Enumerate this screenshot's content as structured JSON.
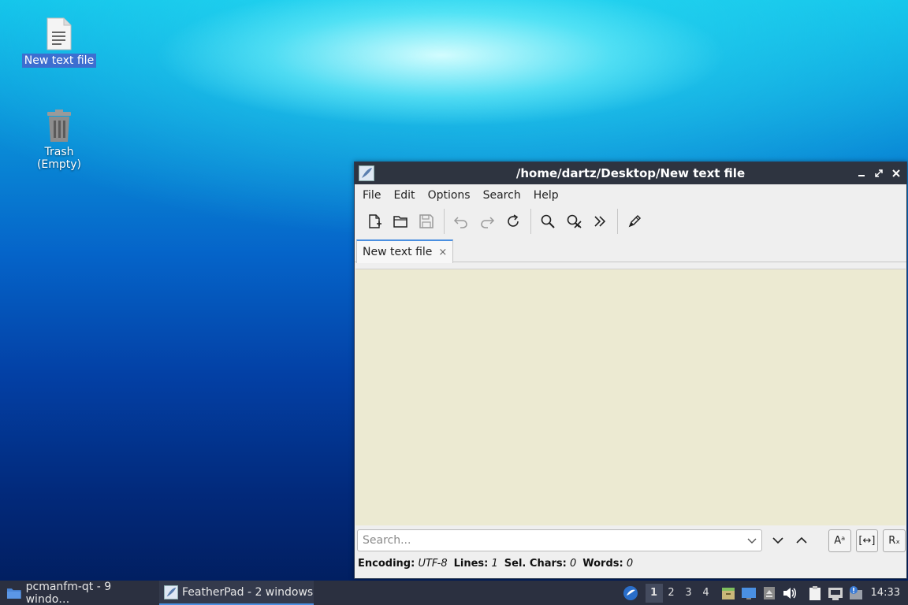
{
  "desktop": {
    "icons": [
      {
        "label": "New text file",
        "icon": "text-file-icon",
        "selected": true
      },
      {
        "label": "Trash (Empty)",
        "icon": "trash-icon",
        "selected": false
      }
    ]
  },
  "window": {
    "title": "/home/dartz/Desktop/New text file",
    "menu": [
      "File",
      "Edit",
      "Options",
      "Search",
      "Help"
    ],
    "toolbar_icons": [
      "new-file-icon",
      "open-folder-icon",
      "save-icon",
      "undo-icon",
      "redo-icon",
      "reload-icon",
      "find-icon",
      "replace-icon",
      "go-to-icon",
      "edit-pen-icon"
    ],
    "tab": {
      "label": "New text file",
      "close": "×"
    },
    "search": {
      "placeholder": "Search...",
      "case_label": "Aᵃ",
      "whole_label": "[↔]",
      "regex_label": "Rₓ"
    },
    "status": {
      "encoding_label": "Encoding:",
      "encoding_value": "UTF-8",
      "lines_label": "Lines:",
      "lines_value": "1",
      "sel_label": "Sel. Chars:",
      "sel_value": "0",
      "words_label": "Words:",
      "words_value": "0"
    }
  },
  "taskbar": {
    "tasks": [
      {
        "label": "pcmanfm-qt - 9 windo…",
        "icon": "folder-icon",
        "active": false
      },
      {
        "label": "FeatherPad - 2 windows",
        "icon": "featherpad-icon",
        "active": true
      }
    ],
    "workspaces": [
      "1",
      "2",
      "3",
      "4"
    ],
    "clock": "14:33"
  },
  "colors": {
    "editor_bg": "#ecead2",
    "titlebar_bg": "#2e3440",
    "taskbar_bg": "#2b3040",
    "accent": "#4a8fe0"
  }
}
